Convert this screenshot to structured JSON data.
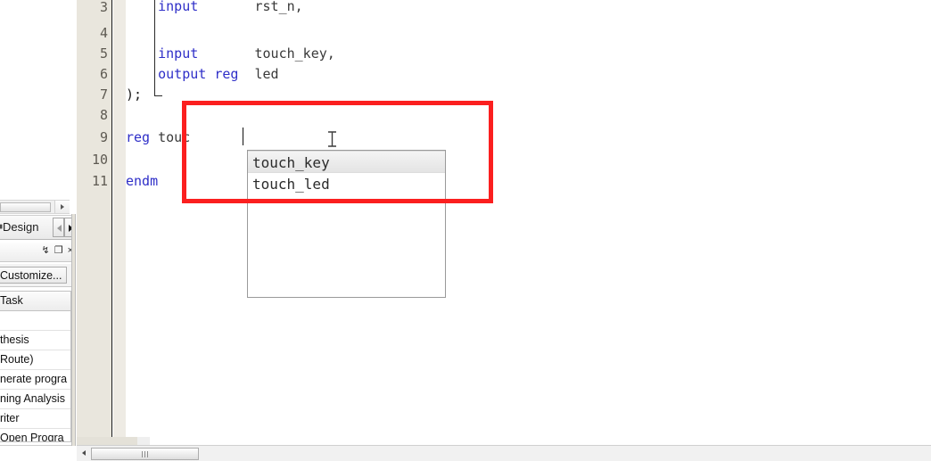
{
  "left_panel": {
    "tab": {
      "label": "Design",
      "icon": "layout-icon",
      "nav_prev": "prev-tab-arrow",
      "nav_next": "next-tab-arrow"
    },
    "titlebar": {
      "pin": "↯",
      "float": "❐",
      "close": "×"
    },
    "toolbar": {
      "customize_label": "Customize..."
    },
    "table": {
      "column_header": "Task",
      "rows": [
        "",
        "thesis",
        "Route)",
        "nerate progra",
        "ning Analysis",
        "riter",
        "Open Progra"
      ]
    }
  },
  "editor": {
    "gutter_numbers": [
      "3",
      "4",
      "5",
      "6",
      "7",
      "8",
      "9",
      "10",
      "11"
    ],
    "lines": [
      {
        "num": "3",
        "segments": [
          {
            "t": "    ",
            "c": "punct"
          },
          {
            "t": "input",
            "c": "kw"
          },
          {
            "t": "       rst_n,",
            "c": "id"
          }
        ]
      },
      {
        "num": "4",
        "segments": [
          {
            "t": "",
            "c": "id"
          }
        ]
      },
      {
        "num": "5",
        "segments": [
          {
            "t": "    ",
            "c": "punct"
          },
          {
            "t": "input",
            "c": "kw"
          },
          {
            "t": "       touch_key,",
            "c": "id"
          }
        ]
      },
      {
        "num": "6",
        "segments": [
          {
            "t": "    ",
            "c": "punct"
          },
          {
            "t": "output reg",
            "c": "kw"
          },
          {
            "t": "  led",
            "c": "id"
          }
        ]
      },
      {
        "num": "7",
        "segments": [
          {
            "t": ");",
            "c": "punct"
          }
        ]
      },
      {
        "num": "8",
        "segments": [
          {
            "t": "",
            "c": "id"
          }
        ]
      },
      {
        "num": "9",
        "segments": [
          {
            "t": "",
            "c": "punct"
          },
          {
            "t": "reg",
            "c": "kw"
          },
          {
            "t": " touc",
            "c": "id"
          }
        ]
      },
      {
        "num": "10",
        "segments": [
          {
            "t": "",
            "c": "id"
          }
        ]
      },
      {
        "num": "11",
        "segments": [
          {
            "t": "endm",
            "c": "kw"
          }
        ]
      }
    ],
    "caret_text": "touc"
  },
  "autocomplete": {
    "items": [
      {
        "label": "touch_key",
        "selected": true
      },
      {
        "label": "touch_led",
        "selected": false
      }
    ]
  },
  "annotation": {
    "color": "#fb1f1f"
  },
  "colors": {
    "keyword": "#2f2fc8",
    "identifier": "#3a3a3a",
    "gutter_bg": "#e9e6dd",
    "annotation_red": "#fb1f1f",
    "selection_bg": "#e8e8e8"
  }
}
